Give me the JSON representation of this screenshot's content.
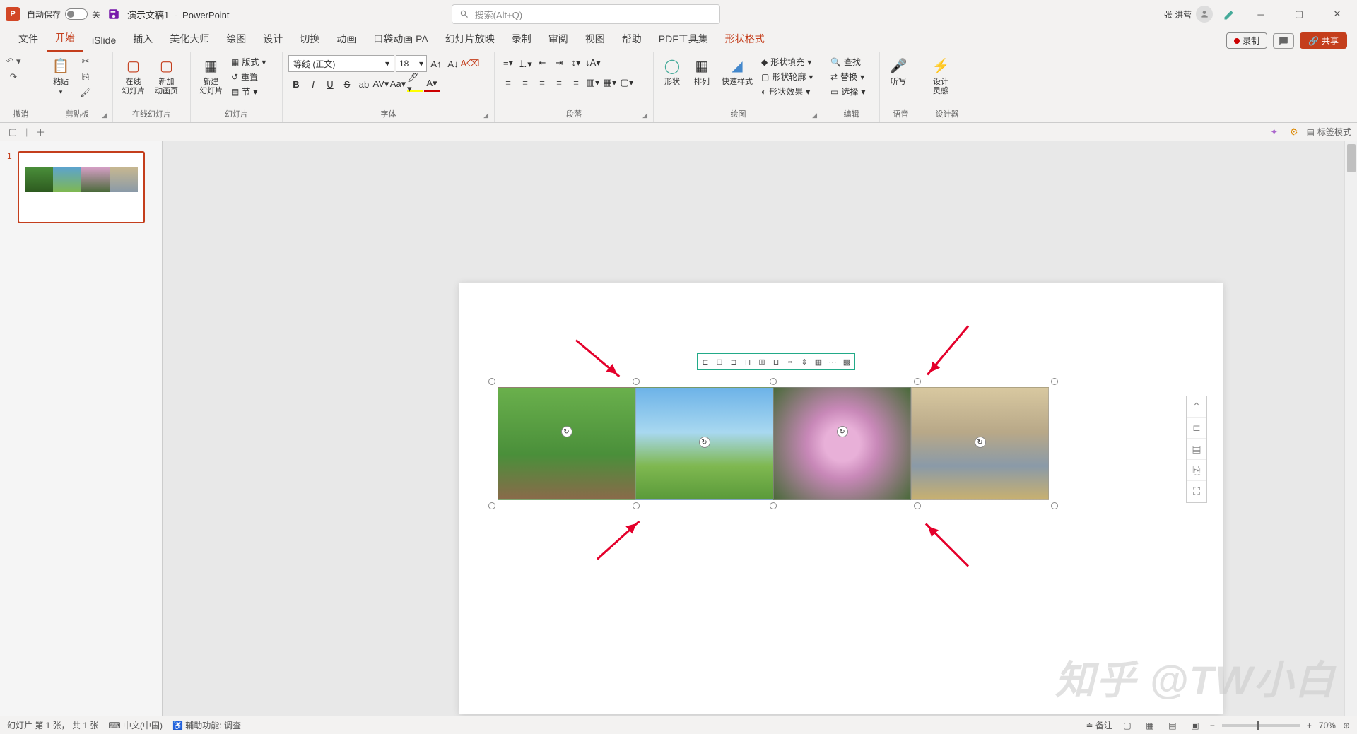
{
  "title": {
    "autosave": "自动保存",
    "autosave_state": "关",
    "doc": "演示文稿1",
    "app": "PowerPoint"
  },
  "search": {
    "placeholder": "搜索(Alt+Q)"
  },
  "user": {
    "name": "张 洪营"
  },
  "tabs": {
    "file": "文件",
    "home": "开始",
    "islide": "iSlide",
    "insert": "插入",
    "beautify": "美化大师",
    "drawing": "绘图",
    "design": "设计",
    "transition": "切换",
    "animation": "动画",
    "pocket": "口袋动画 PA",
    "slideshow": "幻灯片放映",
    "record": "录制",
    "review": "审阅",
    "view": "视图",
    "help": "帮助",
    "pdf": "PDF工具集",
    "shapefmt": "形状格式"
  },
  "tabs_right": {
    "record": "录制",
    "share": "共享"
  },
  "ribbon": {
    "undo": "撤消",
    "paste": "粘贴",
    "clipboard": "剪贴板",
    "online_slide": "在线\n幻灯片",
    "new_anim": "新加\n动画页",
    "online_slides": "在线幻灯片",
    "new_slide": "新建\n幻灯片",
    "layout": "版式",
    "reset": "重置",
    "section": "节",
    "slides": "幻灯片",
    "font_name": "等线 (正文)",
    "font_size": "18",
    "font": "字体",
    "para": "段落",
    "shape": "形状",
    "arrange": "排列",
    "quickstyle": "快速样式",
    "fill": "形状填充",
    "outline": "形状轮廓",
    "effects": "形状效果",
    "draw": "绘图",
    "find": "查找",
    "replace": "替换",
    "select": "选择",
    "edit": "编辑",
    "dictate": "听写",
    "voice": "语音",
    "designer": "设计\n灵感",
    "designer_grp": "设计器"
  },
  "secbar": {
    "tagmode": "标签模式"
  },
  "thumb": {
    "num": "1"
  },
  "status": {
    "slide": "幻灯片 第 1 张， 共 1 张",
    "lang": "中文(中国)",
    "access": "辅助功能: 调查",
    "notes": "备注",
    "zoom": "70%"
  },
  "watermark": "知乎 @TW小白"
}
